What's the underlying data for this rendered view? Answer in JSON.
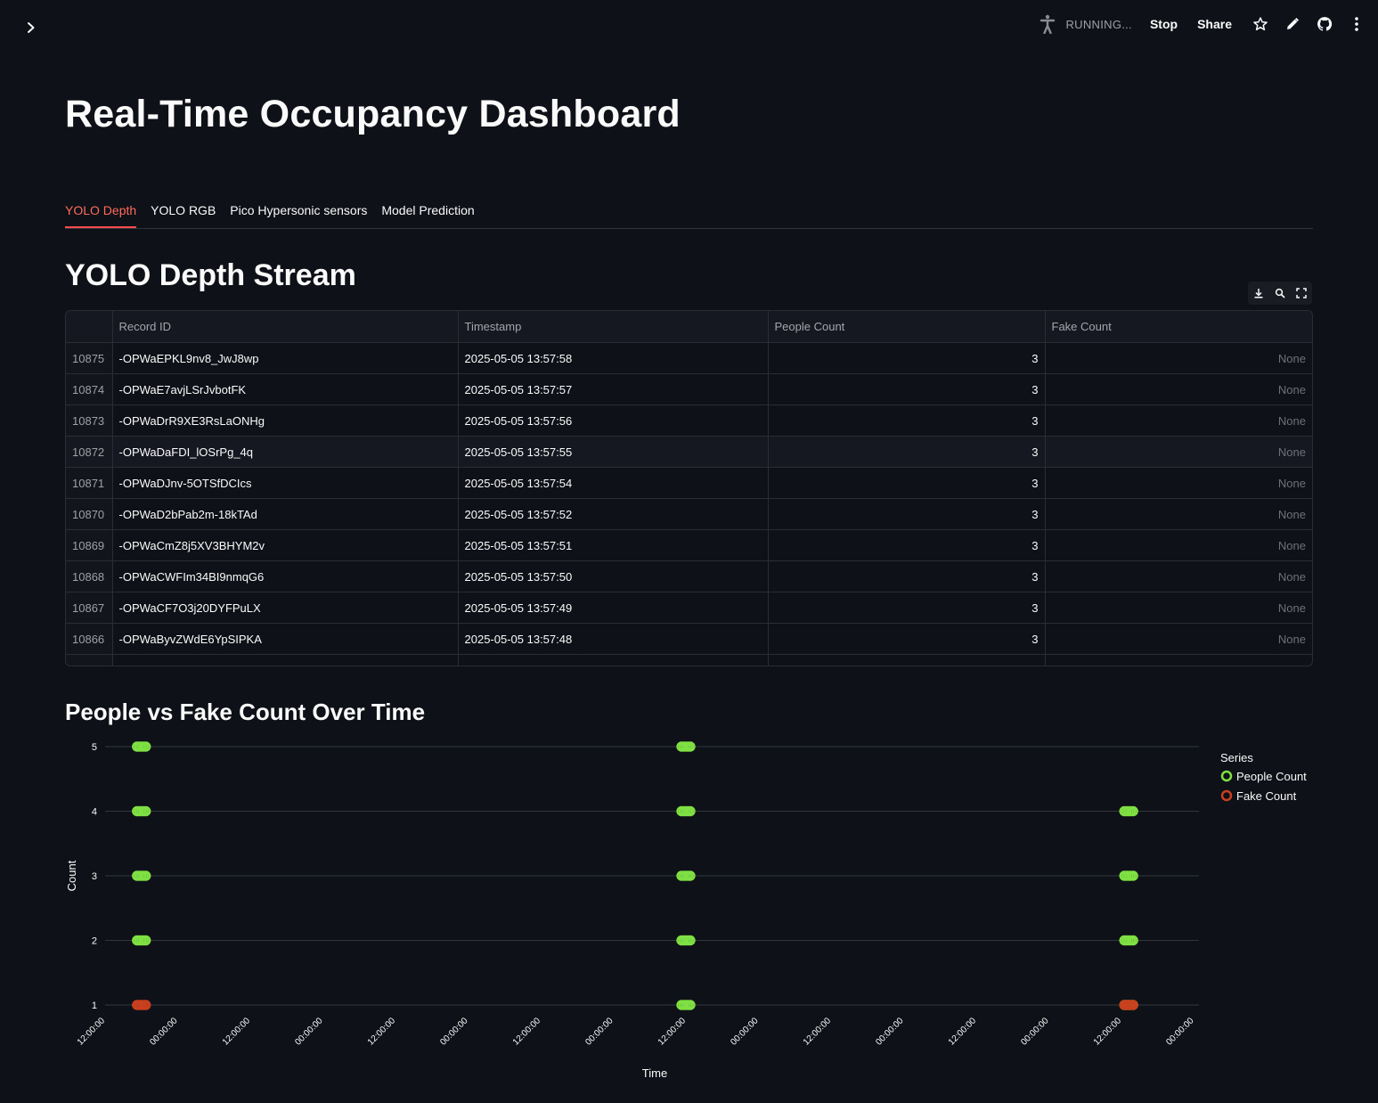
{
  "header": {
    "status_text": "RUNNING...",
    "stop_label": "Stop",
    "share_label": "Share",
    "icons": [
      "running-person-icon",
      "star-icon",
      "pencil-icon",
      "github-icon",
      "kebab-menu-icon"
    ]
  },
  "page": {
    "title": "Real-Time Occupancy Dashboard"
  },
  "tabs": [
    {
      "label": "YOLO Depth",
      "active": true
    },
    {
      "label": "YOLO RGB",
      "active": false
    },
    {
      "label": "Pico Hypersonic sensors",
      "active": false
    },
    {
      "label": "Model Prediction",
      "active": false
    }
  ],
  "stream": {
    "title": "YOLO Depth Stream",
    "columns": [
      "",
      "Record ID",
      "Timestamp",
      "People Count",
      "Fake Count"
    ],
    "rows": [
      {
        "index": "10875",
        "record_id": "-OPWaEPKL9nv8_JwJ8wp",
        "timestamp": "2025-05-05 13:57:58",
        "people": "3",
        "fake": "None"
      },
      {
        "index": "10874",
        "record_id": "-OPWaE7avjLSrJvbotFK",
        "timestamp": "2025-05-05 13:57:57",
        "people": "3",
        "fake": "None"
      },
      {
        "index": "10873",
        "record_id": "-OPWaDrR9XE3RsLaONHg",
        "timestamp": "2025-05-05 13:57:56",
        "people": "3",
        "fake": "None"
      },
      {
        "index": "10872",
        "record_id": "-OPWaDaFDI_lOSrPg_4q",
        "timestamp": "2025-05-05 13:57:55",
        "people": "3",
        "fake": "None"
      },
      {
        "index": "10871",
        "record_id": "-OPWaDJnv-5OTSfDCIcs",
        "timestamp": "2025-05-05 13:57:54",
        "people": "3",
        "fake": "None"
      },
      {
        "index": "10870",
        "record_id": "-OPWaD2bPab2m-18kTAd",
        "timestamp": "2025-05-05 13:57:52",
        "people": "3",
        "fake": "None"
      },
      {
        "index": "10869",
        "record_id": "-OPWaCmZ8j5XV3BHYM2v",
        "timestamp": "2025-05-05 13:57:51",
        "people": "3",
        "fake": "None"
      },
      {
        "index": "10868",
        "record_id": "-OPWaCWFIm34BI9nmqG6",
        "timestamp": "2025-05-05 13:57:50",
        "people": "3",
        "fake": "None"
      },
      {
        "index": "10867",
        "record_id": "-OPWaCF7O3j20DYFPuLX",
        "timestamp": "2025-05-05 13:57:49",
        "people": "3",
        "fake": "None"
      },
      {
        "index": "10866",
        "record_id": "-OPWaByvZWdE6YpSIPKA",
        "timestamp": "2025-05-05 13:57:48",
        "people": "3",
        "fake": "None"
      }
    ]
  },
  "chart_section": {
    "title": "People vs Fake Count Over Time"
  },
  "chart_data": {
    "type": "scatter",
    "xlabel": "Time",
    "ylabel": "Count",
    "x_ticks": [
      "12:00:00",
      "00:00:00",
      "12:00:00",
      "00:00:00",
      "12:00:00",
      "00:00:00",
      "12:00:00",
      "00:00:00",
      "12:00:00",
      "00:00:00",
      "12:00:00",
      "00:00:00",
      "12:00:00",
      "00:00:00",
      "12:00:00",
      "00:00:00"
    ],
    "y_ticks": [
      1,
      2,
      3,
      4,
      5
    ],
    "ylim": [
      1,
      5
    ],
    "legend_title": "Series",
    "legend_position": "right",
    "grid": true,
    "series": [
      {
        "name": "People Count",
        "color": "#7ee042",
        "clusters": [
          {
            "x_tick_index": 0.5,
            "values": [
              5,
              4,
              3,
              2
            ]
          },
          {
            "x_tick_index": 8.0,
            "values": [
              5,
              4,
              3,
              2,
              1
            ]
          },
          {
            "x_tick_index": 14.1,
            "values": [
              4,
              3,
              2,
              1
            ]
          }
        ]
      },
      {
        "name": "Fake Count",
        "color": "#c8401e",
        "clusters": [
          {
            "x_tick_index": 0.5,
            "values": [
              1
            ]
          },
          {
            "x_tick_index": 14.1,
            "values": [
              1
            ]
          }
        ]
      }
    ]
  }
}
